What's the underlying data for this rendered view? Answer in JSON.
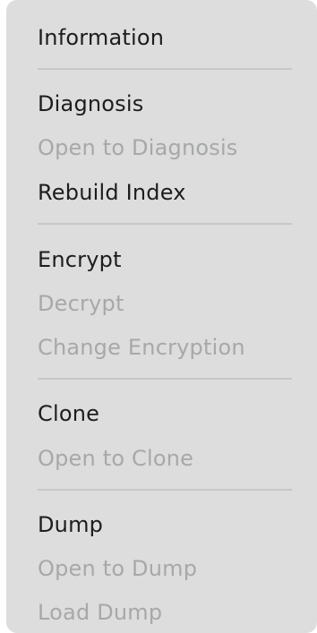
{
  "menu": {
    "items": [
      {
        "label": "Information",
        "enabled": true
      },
      {
        "label": "Diagnosis",
        "enabled": true
      },
      {
        "label": "Open to Diagnosis",
        "enabled": false
      },
      {
        "label": "Rebuild Index",
        "enabled": true
      },
      {
        "label": "Encrypt",
        "enabled": true
      },
      {
        "label": "Decrypt",
        "enabled": false
      },
      {
        "label": "Change Encryption",
        "enabled": false
      },
      {
        "label": "Clone",
        "enabled": true
      },
      {
        "label": "Open to Clone",
        "enabled": false
      },
      {
        "label": "Dump",
        "enabled": true
      },
      {
        "label": "Open to Dump",
        "enabled": false
      },
      {
        "label": "Load Dump",
        "enabled": false
      }
    ]
  }
}
